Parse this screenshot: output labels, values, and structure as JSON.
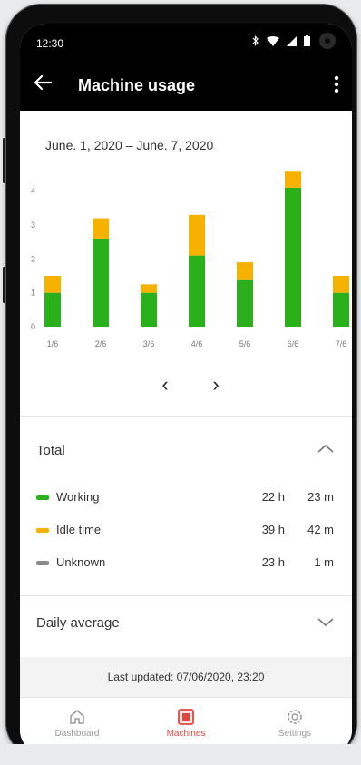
{
  "status": {
    "time": "12:30"
  },
  "appbar": {
    "title": "Machine usage"
  },
  "date_range": "June. 1, 2020 – June. 7, 2020",
  "chart_data": {
    "type": "bar",
    "stacked": true,
    "categories": [
      "1/6",
      "2/6",
      "3/6",
      "4/6",
      "5/6",
      "6/6",
      "7/6"
    ],
    "y_ticks": [
      "0",
      "1",
      "2",
      "3",
      "4"
    ],
    "ylim": [
      0,
      4.5
    ],
    "series": [
      {
        "values": [
          1.0,
          2.6,
          1.0,
          2.1,
          1.4,
          4.1,
          1.0
        ],
        "color": "#29b01a"
      },
      {
        "values": [
          0.5,
          0.6,
          0.25,
          1.2,
          0.5,
          0.5,
          0.5
        ],
        "color": "#f7b200"
      }
    ],
    "grid": false
  },
  "total": {
    "label": "Total",
    "rows": [
      {
        "name": "Working",
        "hours": "22 h",
        "minutes": "23 m",
        "color": "#29b01a"
      },
      {
        "name": "Idle time",
        "hours": "39 h",
        "minutes": "42 m",
        "color": "#f7b200"
      },
      {
        "name": "Unknown",
        "hours": "23 h",
        "minutes": "1 m",
        "color": "#8a8a8a"
      }
    ]
  },
  "daily_average": {
    "label": "Daily average"
  },
  "last_updated": "Last updated: 07/06/2020, 23:20",
  "nav": [
    {
      "label": "Dashboard",
      "icon": "home-icon"
    },
    {
      "label": "Machines",
      "icon": "machine-icon",
      "active": true
    },
    {
      "label": "Settings",
      "icon": "gear-icon"
    }
  ]
}
